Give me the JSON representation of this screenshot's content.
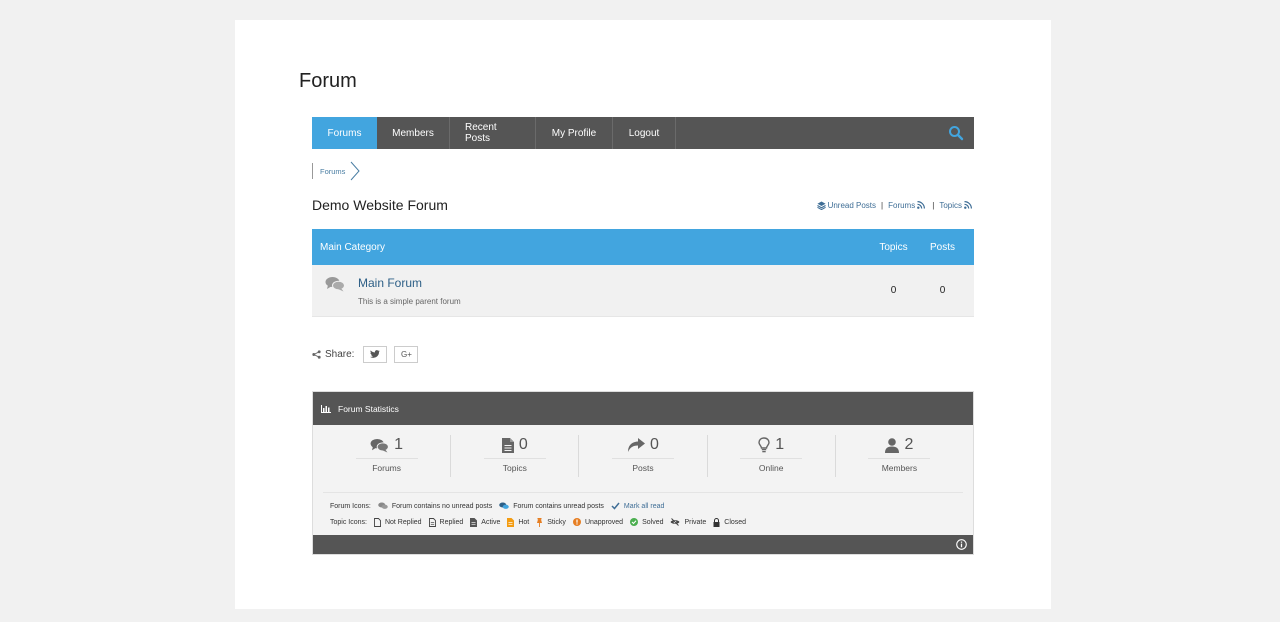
{
  "page": {
    "title": "Forum"
  },
  "nav": {
    "items": [
      {
        "label": "Forums",
        "active": true
      },
      {
        "label": "Members"
      },
      {
        "label": "Recent Posts"
      },
      {
        "label": "My Profile"
      },
      {
        "label": "Logout"
      }
    ],
    "search_icon": "search-icon"
  },
  "breadcrumb": {
    "items": [
      "Forums"
    ]
  },
  "forum": {
    "title": "Demo Website Forum",
    "links": {
      "unread": "Unread Posts",
      "forums": "Forums",
      "topics": "Topics"
    }
  },
  "category": {
    "name": "Main Category",
    "col_topics": "Topics",
    "col_posts": "Posts",
    "forums": [
      {
        "name": "Main Forum",
        "description": "This is a simple parent forum",
        "topics": "0",
        "posts": "0"
      }
    ]
  },
  "share": {
    "label": "Share:",
    "buttons": [
      "twitter-icon",
      "google-plus-icon"
    ],
    "gplus_text": "G+"
  },
  "stats": {
    "title": "Forum Statistics",
    "items": [
      {
        "icon": "comments-icon",
        "value": "1",
        "label": "Forums"
      },
      {
        "icon": "document-icon",
        "value": "0",
        "label": "Topics"
      },
      {
        "icon": "reply-icon",
        "value": "0",
        "label": "Posts"
      },
      {
        "icon": "lightbulb-icon",
        "value": "1",
        "label": "Online"
      },
      {
        "icon": "user-icon",
        "value": "2",
        "label": "Members"
      }
    ],
    "legend": {
      "forum_icons_label": "Forum Icons:",
      "no_unread": "Forum contains no unread posts",
      "unread": "Forum contains unread posts",
      "mark_all_read": "Mark all read",
      "topic_icons_label": "Topic Icons:",
      "topic_icons": [
        "Not Replied",
        "Replied",
        "Active",
        "Hot",
        "Sticky",
        "Unapproved",
        "Solved",
        "Private",
        "Closed"
      ]
    }
  },
  "colors": {
    "accent": "#42a5df",
    "dark": "#555555",
    "link": "#2d5f86"
  }
}
